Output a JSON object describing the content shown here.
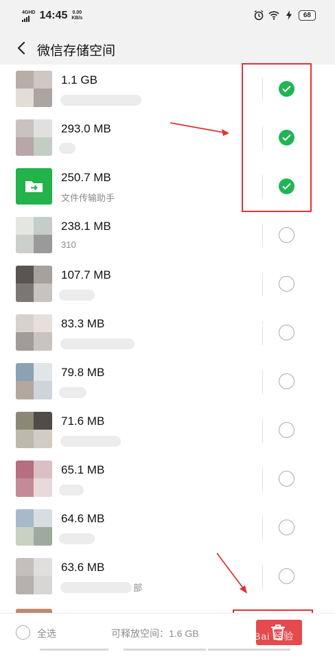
{
  "status_bar": {
    "network": "4GHD",
    "time": "14:45",
    "speed_value": "0.00",
    "speed_unit": "KB/s",
    "battery": "68"
  },
  "header": {
    "back_icon": "chevron-left-icon",
    "title": "微信存储空间"
  },
  "items": [
    {
      "size": "1.1 GB",
      "subtitle": "",
      "checked": true,
      "thumb": "blurred-avatar"
    },
    {
      "size": "293.0 MB",
      "subtitle": "",
      "checked": true,
      "thumb": "blurred-avatar"
    },
    {
      "size": "250.7 MB",
      "subtitle": "文件传输助手",
      "checked": true,
      "thumb": "file-transfer-icon"
    },
    {
      "size": "238.1 MB",
      "subtitle": "310",
      "checked": false,
      "thumb": "blurred-avatar"
    },
    {
      "size": "107.7 MB",
      "subtitle": "",
      "checked": false,
      "thumb": "blurred-avatar"
    },
    {
      "size": "83.3 MB",
      "subtitle": "",
      "checked": false,
      "thumb": "blurred-avatar"
    },
    {
      "size": "79.8 MB",
      "subtitle": "",
      "checked": false,
      "thumb": "blurred-avatar"
    },
    {
      "size": "71.6 MB",
      "subtitle": "",
      "checked": false,
      "thumb": "blurred-avatar"
    },
    {
      "size": "65.1 MB",
      "subtitle": "",
      "checked": false,
      "thumb": "blurred-avatar"
    },
    {
      "size": "64.6 MB",
      "subtitle": "",
      "checked": false,
      "thumb": "blurred-avatar"
    },
    {
      "size": "63.6 MB",
      "subtitle": "部",
      "checked": false,
      "thumb": "blurred-avatar"
    }
  ],
  "footer": {
    "select_all_label": "全选",
    "freeable_text": "可释放空间：1.6 GB",
    "delete_icon": "trash-icon",
    "watermark": "Bai 经验"
  },
  "colors": {
    "accent_green": "#1fb556",
    "delete_red": "#e54a4d",
    "annotation_red": "#e03236"
  }
}
